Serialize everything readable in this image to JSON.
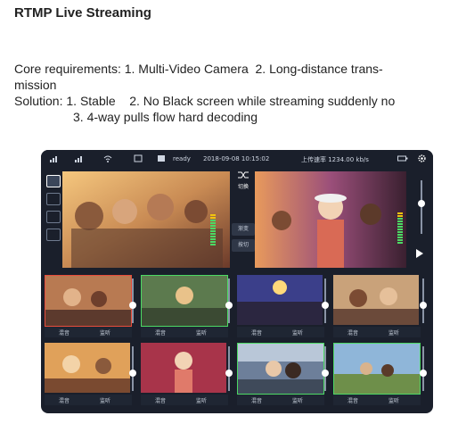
{
  "heading": "RTMP Live Streaming",
  "body": {
    "line1": "Core requirements: 1. Multi-Video Camera  2. Long-distance trans-",
    "line2": "mission",
    "line3": "Solution: 1. Stable    2. No Black screen while streaming suddenly no",
    "line4": "3. 4-way pulls flow hard decoding"
  },
  "statusbar": {
    "status": "ready",
    "datetime": "2018-09-08  10:15:02",
    "upload": "上传速率 1234.00 kb/s"
  },
  "left_icons": [
    "camera-icon",
    "monitor-icon",
    "monitor-icon",
    "monitor-icon"
  ],
  "center_controls": {
    "switch_label": "切换",
    "fade_label": "渐变",
    "cut_label": "按切"
  },
  "cells": [
    {
      "mix": "混音",
      "monitor": "监听"
    },
    {
      "mix": "混音",
      "monitor": "监听"
    },
    {
      "mix": "混音",
      "monitor": "监听"
    },
    {
      "mix": "混音",
      "monitor": "监听"
    },
    {
      "mix": "混音",
      "monitor": "监听"
    },
    {
      "mix": "混音",
      "monitor": "监听"
    },
    {
      "mix": "混音",
      "monitor": "监听"
    },
    {
      "mix": "混音",
      "monitor": "监听"
    }
  ],
  "colors": {
    "panel": "#1a1f2b",
    "active_border": "#e74c3c",
    "selected_border": "#4cd964"
  }
}
